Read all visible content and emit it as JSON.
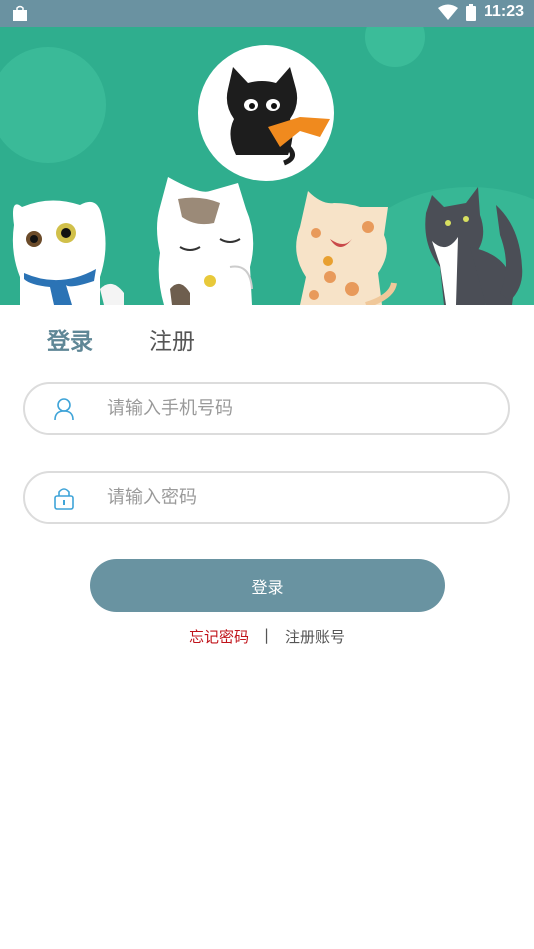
{
  "status_bar": {
    "time": "11:23",
    "icons": [
      "bag-icon",
      "wifi-icon",
      "battery-icon"
    ]
  },
  "tabs": {
    "login": "登录",
    "register": "注册"
  },
  "form": {
    "phone": {
      "placeholder": "请输入手机号码",
      "icon": "user-icon"
    },
    "password": {
      "placeholder": "请输入密码",
      "icon": "lock-icon"
    }
  },
  "login_button": "登录",
  "links": {
    "forgot": "忘记密码",
    "separator": "|",
    "register": "注册账号"
  },
  "colors": {
    "accent": "#6993a1",
    "banner": "#2fae8e",
    "status_bar": "#6a92a1",
    "forgot": "#c0141b"
  }
}
